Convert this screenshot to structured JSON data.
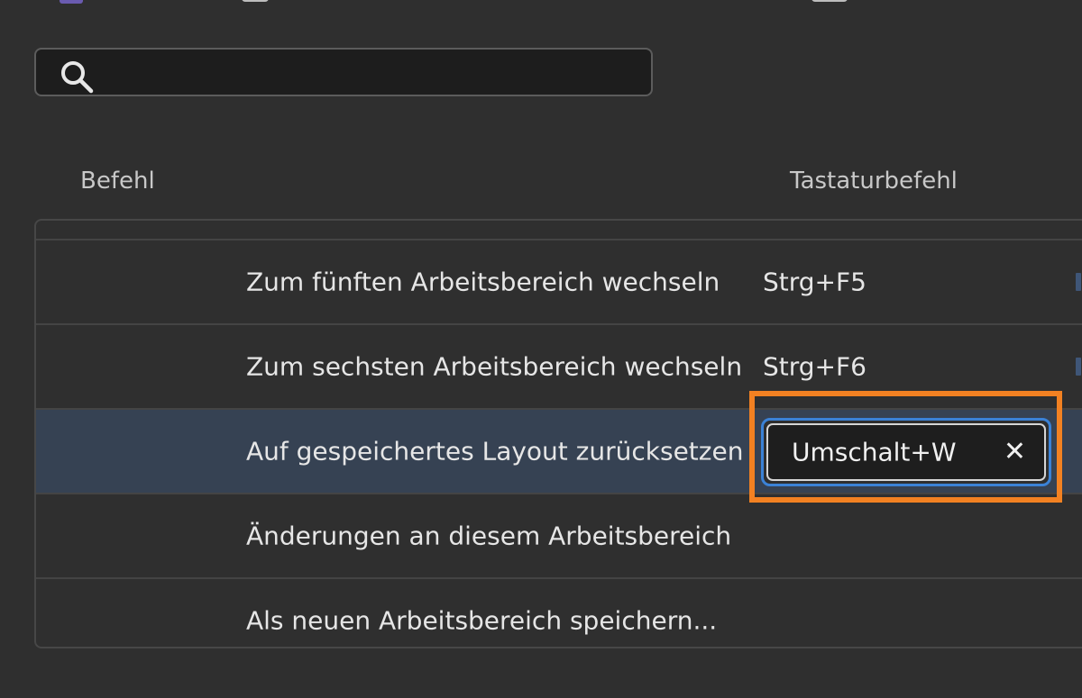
{
  "search": {
    "value": "",
    "placeholder": ""
  },
  "table": {
    "headers": {
      "command": "Befehl",
      "shortcut": "Tastaturbefehl"
    },
    "rows": [
      {
        "command": "Zum fünften Arbeitsbereich wechseln",
        "shortcut": "Strg+F5"
      },
      {
        "command": "Zum sechsten Arbeitsbereich wechseln",
        "shortcut": "Strg+F6"
      },
      {
        "command": "Auf gespeichertes Layout zurücksetzen",
        "shortcut": "Umschalt+W",
        "clear_label": "✕",
        "selected": true
      },
      {
        "command": "Änderungen an diesem Arbeitsbereich",
        "shortcut": ""
      },
      {
        "command": "Als neuen Arbeitsbereich speichern...",
        "shortcut": ""
      }
    ]
  },
  "colors": {
    "highlight": "#f28122",
    "selection": "#364253",
    "focus": "#3b82d6"
  }
}
